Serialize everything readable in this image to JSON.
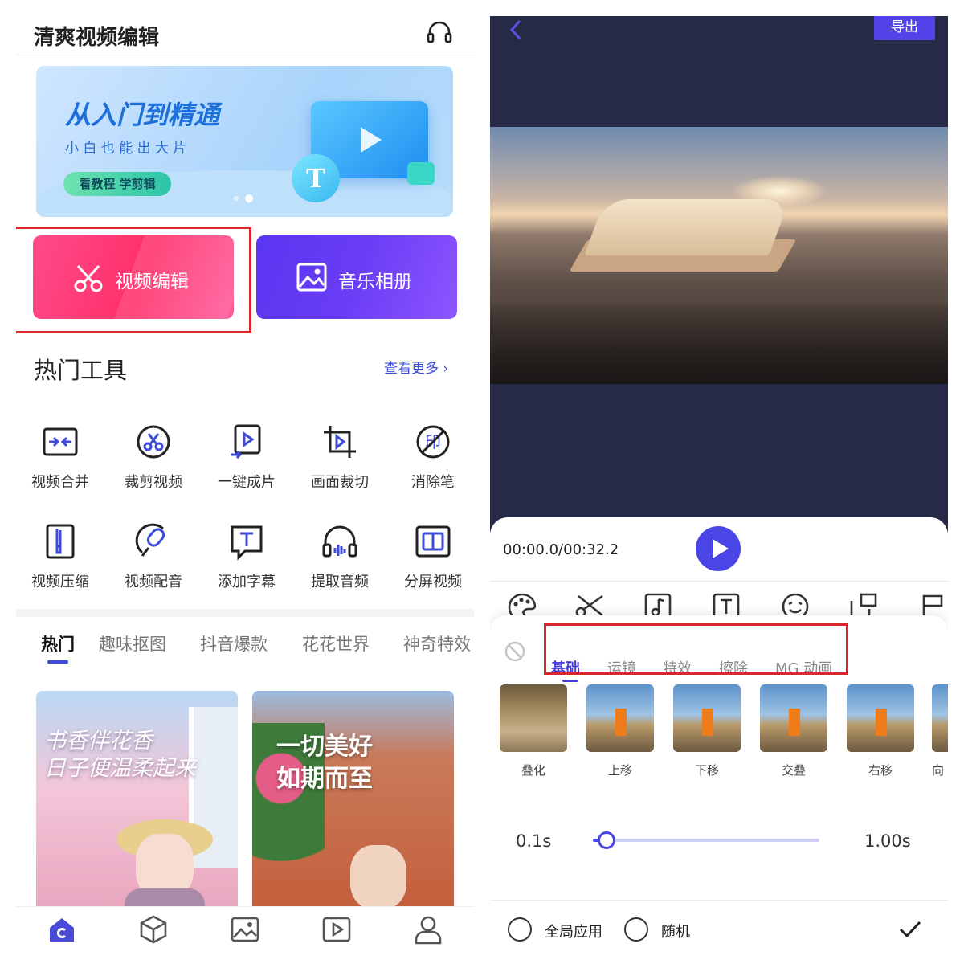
{
  "left": {
    "app_title": "清爽视频编辑",
    "banner": {
      "headline": "从入门到精通",
      "subline": "小 白 也 能 出 大 片",
      "cta": "看教程 学剪辑"
    },
    "video_edit_label": "视频编辑",
    "music_album_label": "音乐相册",
    "hot_tools_title": "热门工具",
    "see_more": "查看更多",
    "tools": [
      {
        "label": "视频合并",
        "icon": "merge-icon"
      },
      {
        "label": "裁剪视频",
        "icon": "scissors-circle-icon"
      },
      {
        "label": "一键成片",
        "icon": "one-click-icon"
      },
      {
        "label": "画面裁切",
        "icon": "crop-icon"
      },
      {
        "label": "消除笔",
        "icon": "eraser-pen-icon"
      },
      {
        "label": "视频压缩",
        "icon": "compress-icon"
      },
      {
        "label": "视频配音",
        "icon": "microphone-icon"
      },
      {
        "label": "添加字幕",
        "icon": "subtitle-icon"
      },
      {
        "label": "提取音频",
        "icon": "headphones-icon"
      },
      {
        "label": "分屏视频",
        "icon": "split-screen-icon"
      }
    ],
    "category_tabs": [
      "热门",
      "趣味抠图",
      "抖音爆款",
      "花花世界",
      "神奇特效"
    ],
    "cards": [
      {
        "text_line1": "书香伴花香",
        "text_line2": "日子便温柔起来"
      },
      {
        "text_line1": "一切美好",
        "text_line2": "如期而至"
      }
    ],
    "bottom_nav": [
      "home-icon",
      "template-cube-icon",
      "gallery-icon",
      "video-play-icon",
      "profile-icon"
    ],
    "accent_color": "#4a4ad8",
    "highlight_color": "#d9262f"
  },
  "right": {
    "back_icon": "chevron-left-icon",
    "export_label": "导出",
    "time_display": "00:00.0/00:32.2",
    "toolbar_icons": [
      "palette-icon",
      "scissors-icon",
      "music-note-icon",
      "text-icon",
      "sticker-face-icon",
      "layout-icon",
      "flag-icon"
    ],
    "transition_tabs": [
      "基础",
      "运镜",
      "特效",
      "擦除",
      "MG 动画"
    ],
    "active_tab": "基础",
    "transitions": [
      "叠化",
      "上移",
      "下移",
      "交叠",
      "右移",
      "向"
    ],
    "slider": {
      "min_label": "0.1s",
      "max_label": "1.00s",
      "value_fraction": 0.06
    },
    "apply_all_label": "全局应用",
    "random_label": "随机",
    "play_color": "#4a46e6"
  }
}
